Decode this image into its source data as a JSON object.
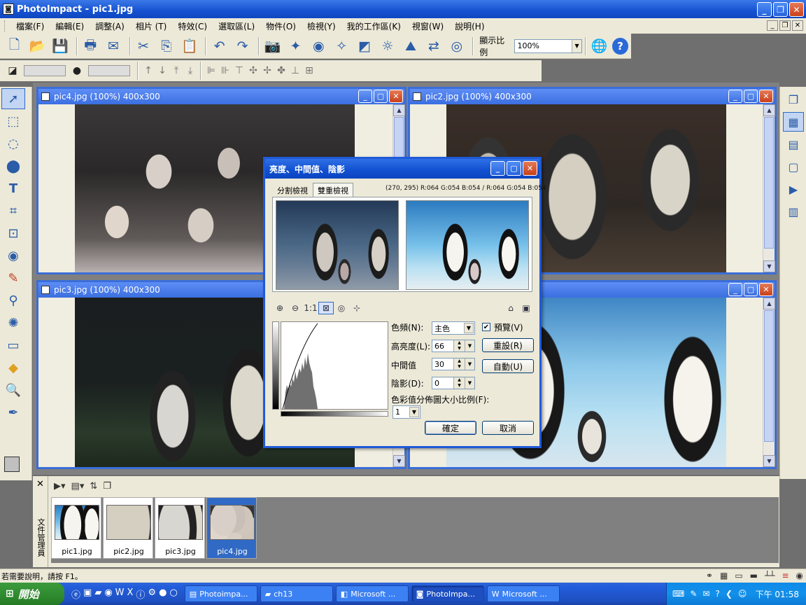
{
  "app": {
    "title": "PhotoImpact - pic1.jpg",
    "icon": "camera-app-icon"
  },
  "menu": [
    "檔案(F)",
    "編輯(E)",
    "調整(A)",
    "相片 (T)",
    "特效(C)",
    "選取區(L)",
    "物件(O)",
    "檢視(Y)",
    "我的工作區(K)",
    "視窗(W)",
    "說明(H)"
  ],
  "toolbar": {
    "zoom_label": "顯示比例",
    "zoom_value": "100%"
  },
  "windows": {
    "pic4": "pic4.jpg (100%) 400x300",
    "pic2": "pic2.jpg (100%) 400x300",
    "pic3": "pic3.jpg (100%) 400x300"
  },
  "dialog": {
    "title": "亮度、中間值、陰影",
    "tab_split": "分割檢視",
    "tab_dual": "雙重檢視",
    "pixel_info": "(270, 295) R:064 G:054 B:054 / R:064 G:054 B:054",
    "zoom_ratio_label": "1:1",
    "channel_label": "色頻(N):",
    "channel_value": "主色",
    "preview_label": "預覽(V)",
    "preview_checked": "✔",
    "brightness_label": "高亮度(L):",
    "brightness_value": "66",
    "midtone_label": "中間值",
    "midtone_value": "30",
    "shadow_label": "陰影(D):",
    "shadow_value": "0",
    "reset_label": "重設(R)",
    "auto_label": "自動(U)",
    "scale_label": "色彩值分佈圖大小比例(F):",
    "scale_value": "1",
    "ok_label": "確定",
    "cancel_label": "取消"
  },
  "docmanager": {
    "side_label": "文件管理員",
    "close": "✕",
    "thumbnails": [
      {
        "name": "pic1.jpg",
        "selected": false
      },
      {
        "name": "pic2.jpg",
        "selected": false
      },
      {
        "name": "pic3.jpg",
        "selected": false
      },
      {
        "name": "pic4.jpg",
        "selected": true
      }
    ]
  },
  "status": {
    "text": "若需要說明，請按 F1。"
  },
  "taskbar": {
    "start": "開始",
    "tasks": [
      {
        "label": "Photoimpa...",
        "active": false
      },
      {
        "label": "ch13",
        "active": false
      },
      {
        "label": "Microsoft ...",
        "active": false
      },
      {
        "label": "PhotoImpa...",
        "active": true
      },
      {
        "label": "Microsoft ...",
        "active": false
      }
    ],
    "clock": "下午 01:58"
  },
  "colors": {
    "title_blue": "#1652d0",
    "xp_green": "#2f8a2f",
    "face": "#ece9d8"
  }
}
